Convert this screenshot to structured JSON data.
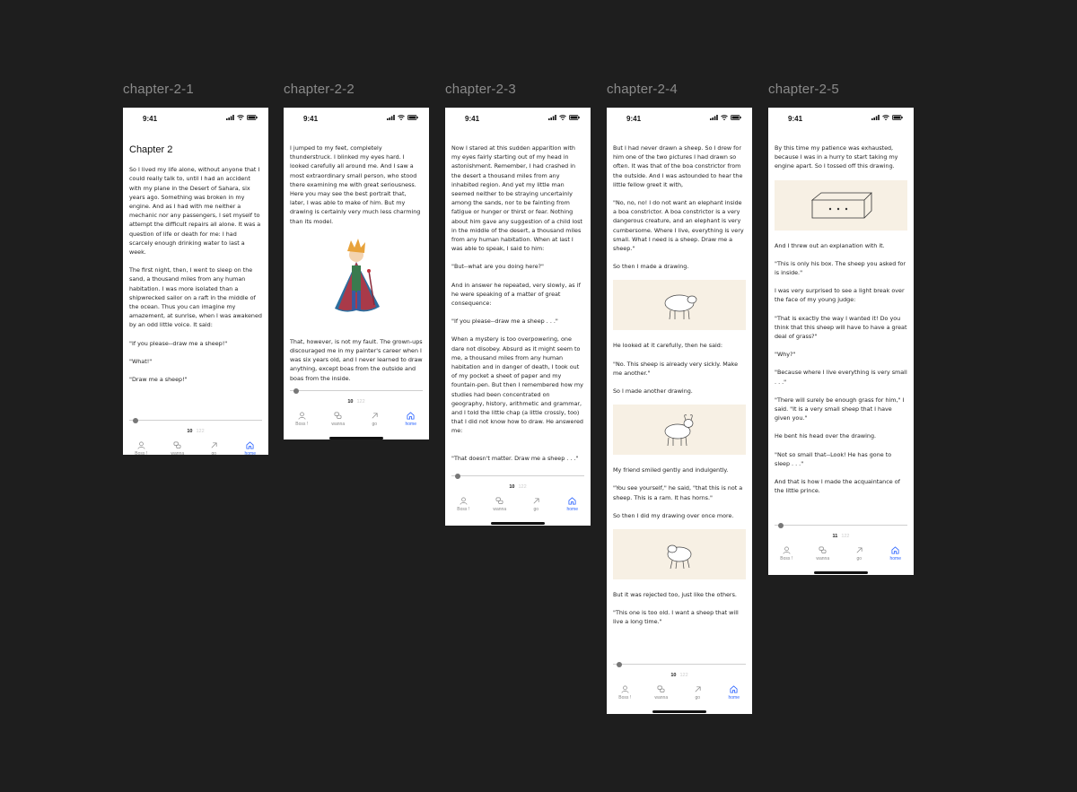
{
  "status_time": "9:41",
  "tabs": [
    "Boss !",
    "wanna",
    "go",
    "home"
  ],
  "frames": [
    {
      "label": "chapter-2-1",
      "chapter_title": "Chapter 2",
      "paragraphs": [
        "So I lived my life alone, without anyone that I could really talk to, until I had an accident with my plane in the Desert of Sahara, six years ago. Something was broken in my engine. And as I had with me neither a mechanic nor any passengers, I set myself to attempt the difficult repairs all alone. It was a question of life or death for me: I had scarcely enough drinking water to last a week.",
        "The first night, then, I went to sleep on the sand, a thousand miles from any human habitation. I was more isolated than a shipwrecked sailor on a raft in the middle of the ocean. Thus you can imagine my amazement, at sunrise, when I was awakened by an odd little voice. It said:",
        "\"If you please--draw me a sheep!\"",
        "\"What!\"",
        "\"Draw me a sheep!\""
      ],
      "page": "10",
      "total": "122"
    },
    {
      "label": "chapter-2-2",
      "paragraphs_before": [
        "I jumped to my feet, completely thunderstruck. I blinked my eyes hard. I looked carefully all around me. And I saw a most extraordinary small person, who stood there examining me with great seriousness. Here you may see the best portrait that, later, I was able to make of him. But my drawing is certainly very much less charming than its model."
      ],
      "paragraphs_after": [
        "That, however, is not my fault. The grown-ups discouraged me in my painter's career when I was six years old, and I never learned to draw anything, except boas from the outside and boas from the inside."
      ],
      "page": "10",
      "total": "122"
    },
    {
      "label": "chapter-2-3",
      "paragraphs": [
        "Now I stared at this sudden apparition with my eyes fairly starting out of my head in astonishment. Remember, I had crashed in the desert a thousand miles from any inhabited region. And yet my little man seemed neither to be straying uncertainly among the sands, nor to be fainting from fatigue or hunger or thirst or fear. Nothing about him gave any suggestion of a child lost in the middle of the desert, a thousand miles from any human habitation. When at last I was able to speak, I said to him:",
        "\"But--what are you doing here?\"",
        "And in answer he repeated, very slowly, as if he were speaking of a matter of great consequence:",
        "\"If you please--draw me a sheep . . .\"",
        "When a mystery is too overpowering, one dare not disobey. Absurd as it might seem to me, a thousand miles from any human habitation and in danger of death, I took out of my pocket a sheet of paper and my fountain-pen. But then I remembered how my studies had been concentrated on geography, history, arithmetic and grammar, and I told the little chap (a little crossly, too) that I did not know how to draw. He answered me:",
        "\"That doesn't matter. Draw me a sheep . . .\""
      ],
      "page": "10",
      "total": "122"
    },
    {
      "label": "chapter-2-4",
      "p1": [
        "But I had never drawn a sheep. So I drew for him one of the two pictures I had drawn so often. It was that of the boa constrictor from the outside. And I was astounded to hear the little fellow greet it with,",
        "\"No, no, no! I do not want an elephant inside a boa constrictor. A boa constrictor is a very dangerous creature, and an elephant is very cumbersome. Where I live, everything is very small. What I need is a sheep. Draw me a sheep.\"",
        "So then I made a drawing."
      ],
      "p2": [
        "He looked at it carefully, then he said:",
        "\"No. This sheep is already very sickly. Make me another.\"",
        "So I made another drawing."
      ],
      "p3": [
        "My friend smiled gently and indulgently.",
        "\"You see yourself,\" he said, \"that this is not a sheep. This is a ram. It has horns.\"",
        "So then I did my drawing over once more."
      ],
      "p4": [
        "But it was rejected too, just like the others.",
        "\"This one is too old. I want a sheep that will live a long time.\""
      ],
      "page": "10",
      "total": "122"
    },
    {
      "label": "chapter-2-5",
      "p1": [
        "By this time my patience was exhausted, because I was in a hurry to start taking my engine apart. So I tossed off this drawing."
      ],
      "p2": [
        "And I threw out an explanation with it.",
        "\"This is only his box. The sheep you asked for is inside.\"",
        "I was very surprised to see a light break over the face of my young judge:",
        "\"That is exactly the way I wanted it! Do you think that this sheep will have to have a great deal of grass?\"",
        "\"Why?\"",
        "\"Because where I live everything is very small . . .\"",
        "\"There will surely be enough grass for him,\" I said. \"It is a very small sheep that I have given you.\"",
        "He bent his head over the drawing.",
        "\"Not so small that--Look! He has gone to sleep . . .\"",
        "And that is how I made the acquaintance of the little prince."
      ],
      "page": "11",
      "total": "122"
    }
  ]
}
